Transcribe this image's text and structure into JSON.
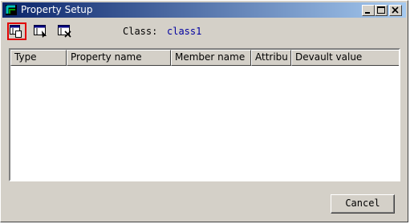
{
  "window": {
    "title": "Property Setup",
    "colors": {
      "titlebar_start": "#0a246a",
      "titlebar_end": "#a6caf0",
      "face": "#d4d0c8",
      "class_value": "#0000a0",
      "selected_outline": "#e00000"
    }
  },
  "toolbar": {
    "buttons": [
      {
        "icon": "new-property-icon",
        "selected": true
      },
      {
        "icon": "edit-property-icon",
        "selected": false
      },
      {
        "icon": "delete-property-icon",
        "selected": false
      }
    ],
    "class_label": "Class:",
    "class_value": "class1"
  },
  "table": {
    "columns": [
      "Type",
      "Property name",
      "Member name",
      "Attribu",
      "Devault value"
    ],
    "rows": []
  },
  "footer": {
    "cancel_label": "Cancel"
  }
}
